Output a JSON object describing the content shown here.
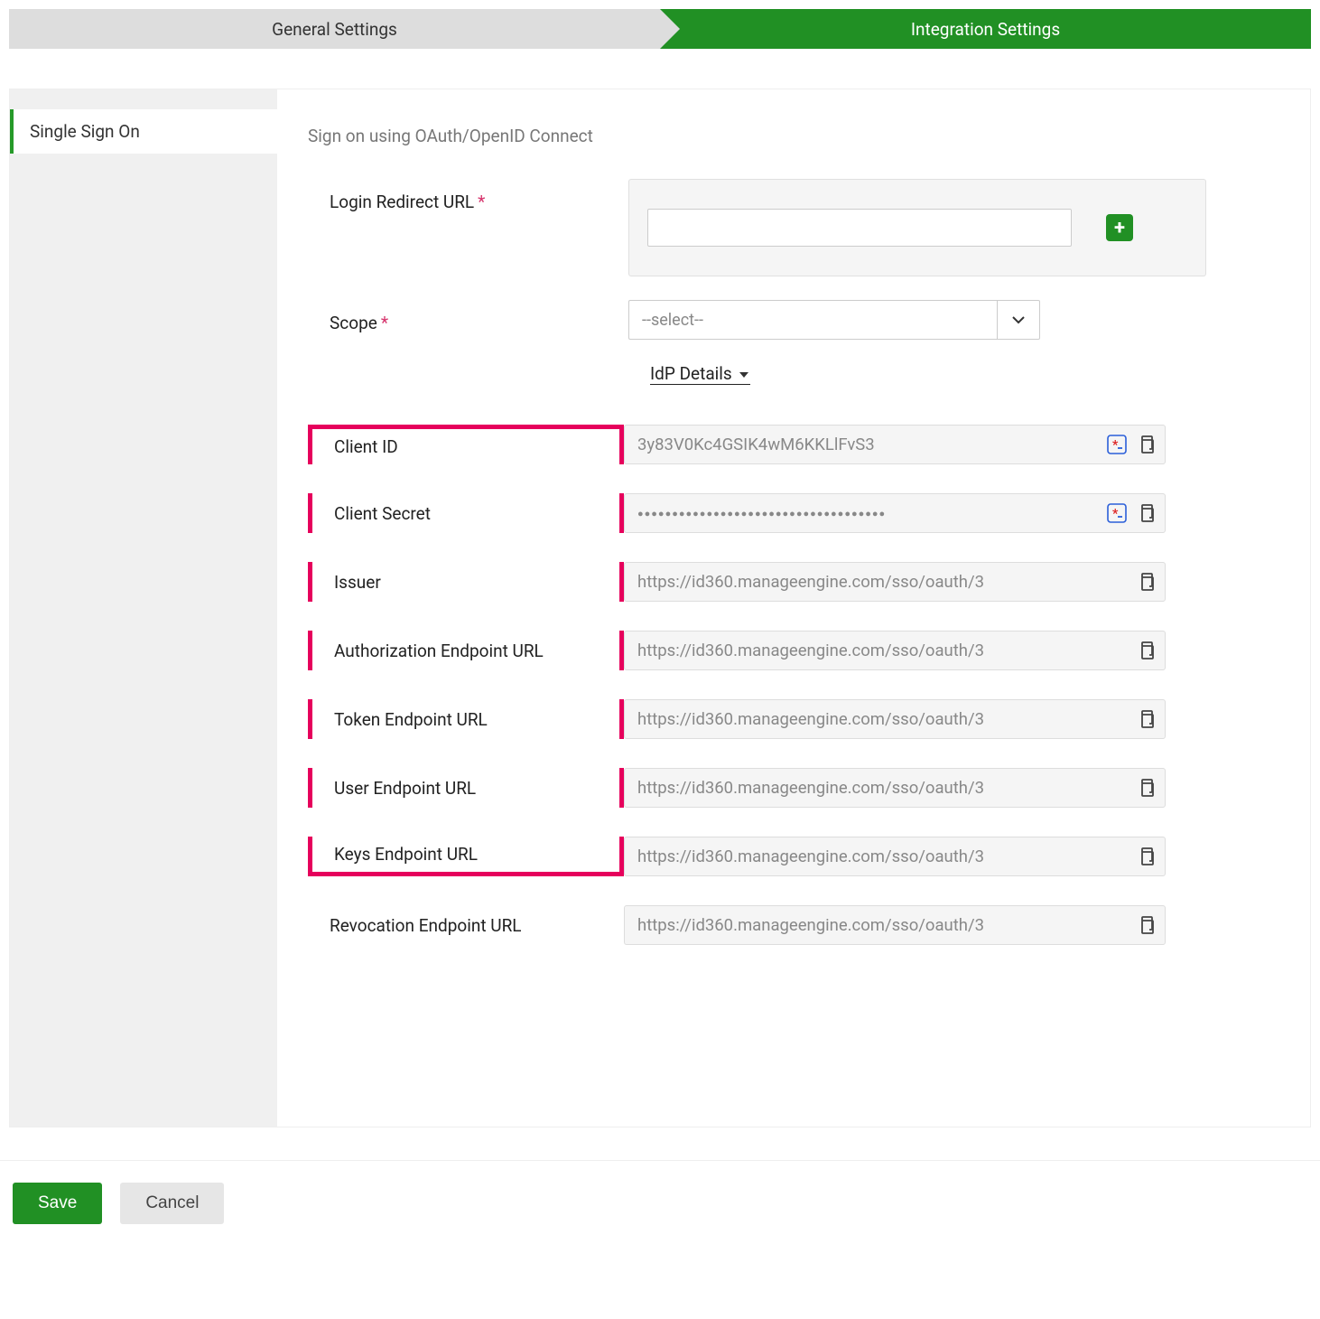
{
  "tabs": {
    "general": "General Settings",
    "integration": "Integration Settings"
  },
  "sidebar": {
    "sso": "Single Sign On"
  },
  "header": "Sign on using OAuth/OpenID Connect",
  "login_redirect": {
    "label": "Login Redirect URL",
    "value": ""
  },
  "scope": {
    "label": "Scope",
    "placeholder": "--select--"
  },
  "idp_toggle": "IdP Details",
  "fields": {
    "client_id": {
      "label": "Client ID",
      "value": "3y83V0Kc4GSIK4wM6KKLlFvS3"
    },
    "client_secret": {
      "label": "Client Secret",
      "value": "●●●●●●●●●●●●●●●●●●●●●●●●●●●●●●●●●●●●"
    },
    "issuer": {
      "label": "Issuer",
      "value": "https://id360.manageengine.com/sso/oauth/3"
    },
    "authz": {
      "label": "Authorization Endpoint URL",
      "value": "https://id360.manageengine.com/sso/oauth/3"
    },
    "token": {
      "label": "Token Endpoint URL",
      "value": "https://id360.manageengine.com/sso/oauth/3"
    },
    "user": {
      "label": "User Endpoint URL",
      "value": "https://id360.manageengine.com/sso/oauth/3"
    },
    "keys": {
      "label": "Keys Endpoint URL",
      "value": "https://id360.manageengine.com/sso/oauth/3"
    },
    "revocation": {
      "label": "Revocation Endpoint URL",
      "value": "https://id360.manageengine.com/sso/oauth/3"
    }
  },
  "buttons": {
    "save": "Save",
    "cancel": "Cancel"
  }
}
